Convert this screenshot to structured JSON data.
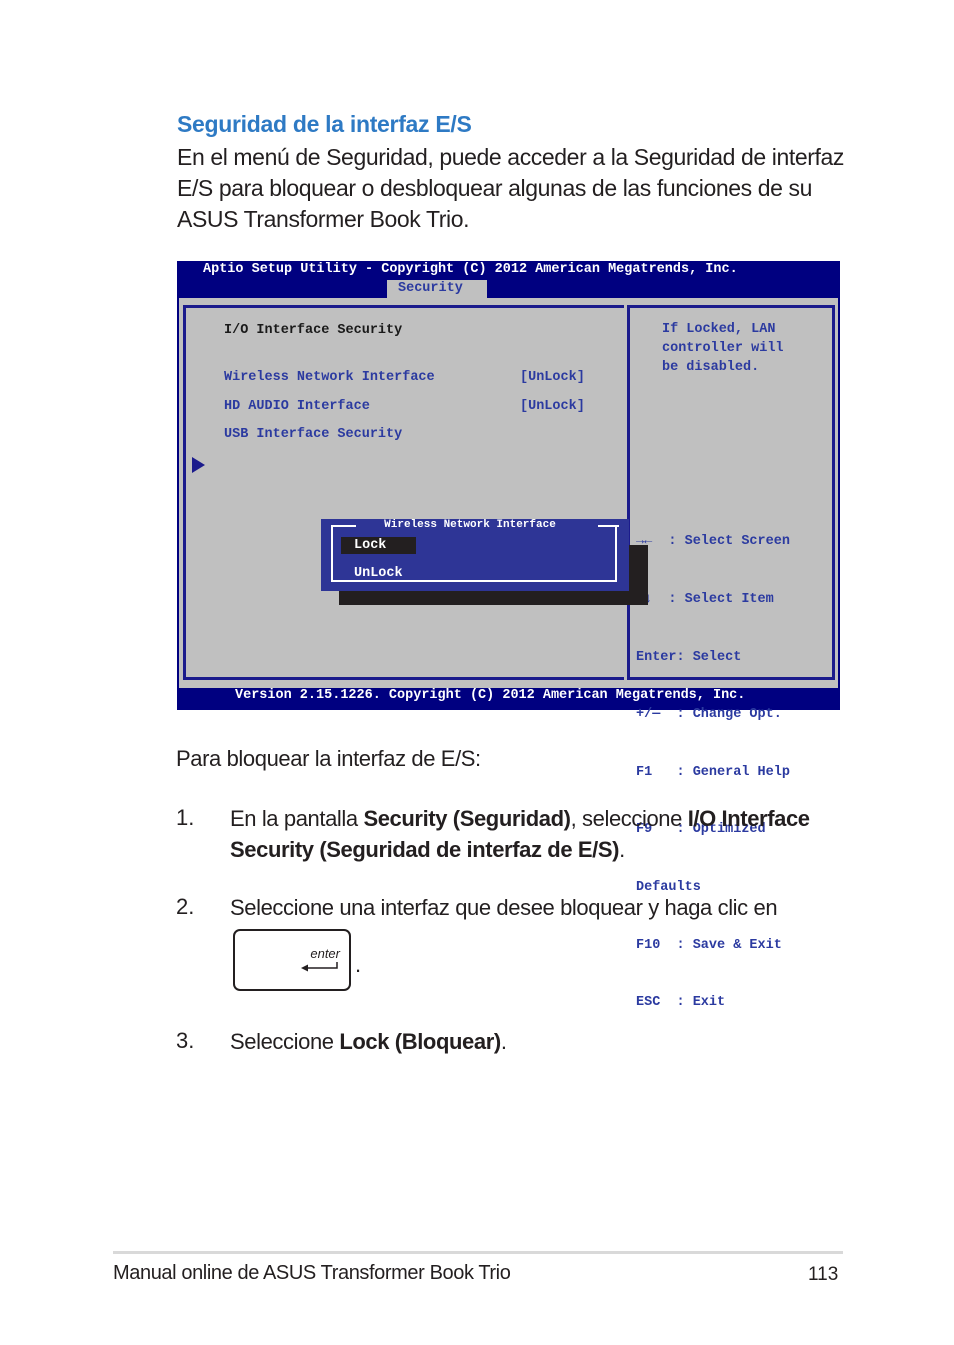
{
  "section_title": "Seguridad de la interfaz E/S",
  "intro": "En el menú de Seguridad, puede acceder a la Seguridad de interfaz E/S para bloquear o desbloquear algunas de las funciones de su ASUS Transformer Book Trio.",
  "bios": {
    "title": "Aptio Setup Utility - Copyright (C) 2012 American Megatrends, Inc.",
    "active_tab": "Security",
    "heading": "I/O Interface Security",
    "items": [
      {
        "label": "Wireless Network Interface",
        "value": "[UnLock]"
      },
      {
        "label": "HD AUDIO Interface",
        "value": "[UnLock]"
      },
      {
        "label": "USB Interface Security",
        "value": ""
      }
    ],
    "help": [
      "If Locked, LAN",
      "controller will",
      "be disabled."
    ],
    "keys": [
      "→←  : Select Screen",
      "↑↓  : Select Item",
      "Enter: Select",
      "+/—  : Change Opt.",
      "F1   : General Help",
      "F9   : Optimized",
      "Defaults",
      "F10  : Save & Exit",
      "ESC  : Exit"
    ],
    "popup": {
      "title": "Wireless Network Interface",
      "options": [
        "Lock",
        "UnLock"
      ],
      "selected": "Lock"
    },
    "footer": "Version 2.15.1226. Copyright (C) 2012 American Megatrends, Inc."
  },
  "instructions": {
    "lead": "Para bloquear la interfaz de E/S:",
    "steps": [
      {
        "num": "1.",
        "parts": [
          "En la pantalla ",
          "Security (Seguridad)",
          ", seleccione ",
          "I/O Interface Security (Seguridad de interfaz de E/S)",
          "."
        ]
      },
      {
        "num": "2.",
        "text": "Seleccione una interfaz que desee bloquear y haga clic en",
        "key_label": "enter",
        "after_key": "."
      },
      {
        "num": "3.",
        "parts": [
          "Seleccione ",
          "Lock (Bloquear)",
          "."
        ]
      }
    ]
  },
  "footer": {
    "text": "Manual online de ASUS Transformer Book Trio",
    "page": "113"
  }
}
